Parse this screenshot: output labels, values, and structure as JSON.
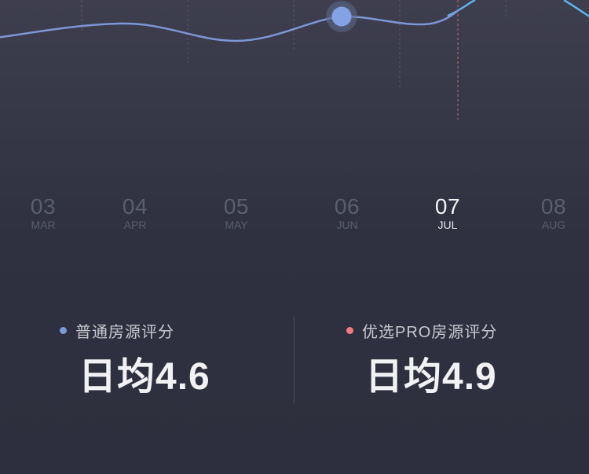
{
  "chart_data": {
    "type": "line",
    "series": [
      {
        "color": "#7e96d6",
        "role": "standard"
      },
      {
        "color": "#5fb2ea",
        "role": "pro"
      }
    ],
    "highlight": {
      "month": "06",
      "color": "#84a3e4"
    },
    "cursor_line_color": "#c96a75"
  },
  "months": [
    {
      "num": "03",
      "abbr": "MAR",
      "active": false
    },
    {
      "num": "04",
      "abbr": "APR",
      "active": false
    },
    {
      "num": "05",
      "abbr": "MAY",
      "active": false
    },
    {
      "num": "06",
      "abbr": "JUN",
      "active": false
    },
    {
      "num": "07",
      "abbr": "JUL",
      "active": true
    },
    {
      "num": "08",
      "abbr": "AUG",
      "active": false
    }
  ],
  "stats": {
    "left": {
      "label": "普通房源评分",
      "value": "日均4.6",
      "dot_color": "#7b9ad8"
    },
    "right": {
      "label": "优选PRO房源评分",
      "value": "日均4.9",
      "dot_color": "#f07c82"
    }
  }
}
